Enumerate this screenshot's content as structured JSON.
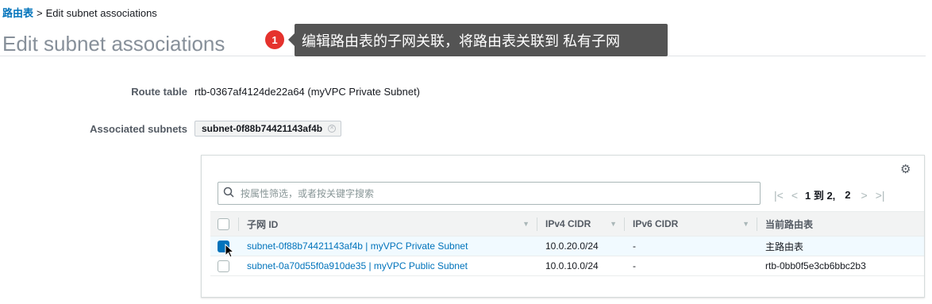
{
  "breadcrumb": {
    "link": "路由表",
    "separator": ">",
    "current": "Edit subnet associations"
  },
  "page_title": "Edit subnet associations",
  "callout": {
    "number": "1",
    "text": "编辑路由表的子网关联，将路由表关联到 私有子网"
  },
  "route_table": {
    "label": "Route table",
    "value": "rtb-0367af4124de22a64 (myVPC Private Subnet)"
  },
  "associated_subnets": {
    "label": "Associated subnets",
    "tokens": [
      "subnet-0f88b74421143af4b"
    ]
  },
  "search": {
    "placeholder": "按属性筛选，或者按关键字搜索"
  },
  "pagination": {
    "range_text": "1 到 2,",
    "page": "2"
  },
  "table": {
    "columns": [
      "子网 ID",
      "IPv4 CIDR",
      "IPv6 CIDR",
      "当前路由表"
    ],
    "rows": [
      {
        "subnet": "subnet-0f88b74421143af4b | myVPC Private Subnet",
        "ipv4": "10.0.20.0/24",
        "ipv6": "-",
        "route_table": "主路由表",
        "selected": true
      },
      {
        "subnet": "subnet-0a70d55f0a910de35 | myVPC Public Subnet",
        "ipv4": "10.0.10.0/24",
        "ipv6": "-",
        "route_table": "rtb-0bb0f5e3cb6bbc2b3",
        "selected": false
      }
    ]
  },
  "colors": {
    "link": "#0073bb",
    "callout_bg": "#545454",
    "badge": "#e5322d",
    "selected_row": "#f1faff"
  }
}
